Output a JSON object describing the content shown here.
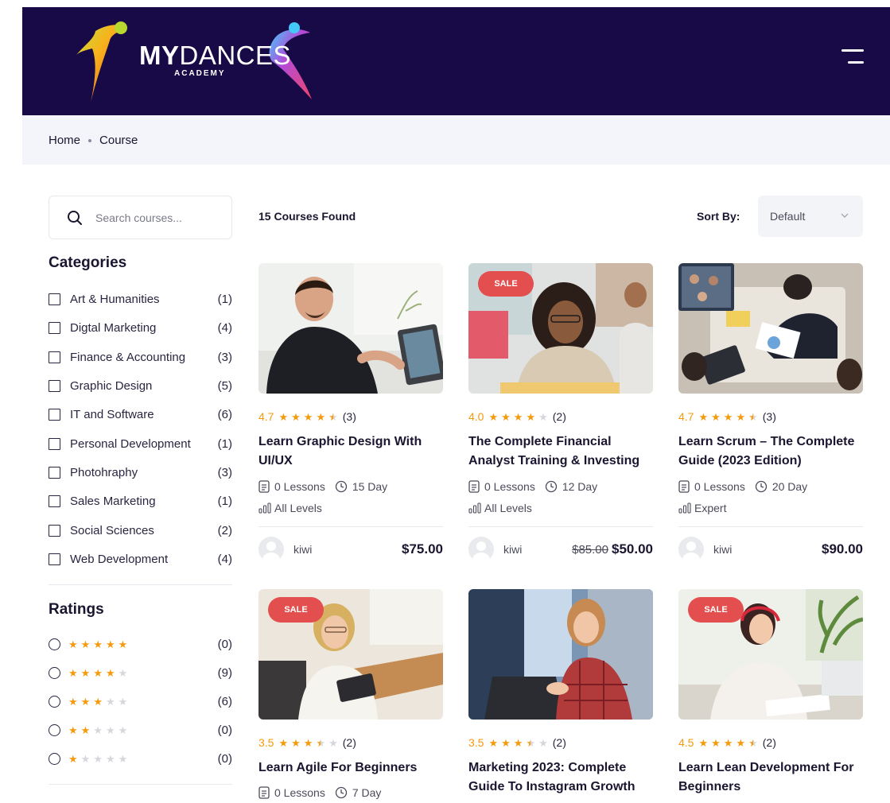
{
  "brand": {
    "name_bold": "MY",
    "name_regular": "DANCES",
    "tagline": "ACADEMY"
  },
  "breadcrumb": {
    "home": "Home",
    "current": "Course"
  },
  "search": {
    "placeholder": "Search courses..."
  },
  "categories": {
    "title": "Categories",
    "items": [
      {
        "label": "Art & Humanities",
        "count": "(1)"
      },
      {
        "label": "Digtal Marketing",
        "count": "(4)"
      },
      {
        "label": "Finance & Accounting",
        "count": "(3)"
      },
      {
        "label": "Graphic Design",
        "count": "(5)"
      },
      {
        "label": "IT and Software",
        "count": "(6)"
      },
      {
        "label": "Personal Development",
        "count": "(1)"
      },
      {
        "label": "Photohraphy",
        "count": "(3)"
      },
      {
        "label": "Sales Marketing",
        "count": "(1)"
      },
      {
        "label": "Social Sciences",
        "count": "(2)"
      },
      {
        "label": "Web Development",
        "count": "(4)"
      }
    ]
  },
  "ratings": {
    "title": "Ratings",
    "items": [
      {
        "stars": 5,
        "count": "(0)"
      },
      {
        "stars": 4,
        "count": "(9)"
      },
      {
        "stars": 3,
        "count": "(6)"
      },
      {
        "stars": 2,
        "count": "(0)"
      },
      {
        "stars": 1,
        "count": "(0)"
      }
    ]
  },
  "toolbar": {
    "found": "15 Courses Found",
    "sort_label": "Sort By:",
    "sort_value": "Default"
  },
  "sale_label": "SALE",
  "courses": [
    {
      "rating": "4.7",
      "rating_value": 4.7,
      "reviews": "(3)",
      "title": "Learn Graphic Design With UI/UX",
      "lessons": "0 Lessons",
      "duration": "15 Day",
      "level": "All Levels",
      "author": "kiwi",
      "old_price": "",
      "price": "$75.00"
    },
    {
      "rating": "4.0",
      "rating_value": 4.0,
      "reviews": "(2)",
      "title": "The Complete Financial Analyst Training & Investing",
      "lessons": "0 Lessons",
      "duration": "12 Day",
      "level": "All Levels",
      "author": "kiwi",
      "old_price": "$85.00",
      "price": "$50.00"
    },
    {
      "rating": "4.7",
      "rating_value": 4.7,
      "reviews": "(3)",
      "title": "Learn Scrum – The Complete Guide (2023 Edition)",
      "lessons": "0 Lessons",
      "duration": "20 Day",
      "level": "Expert",
      "author": "kiwi",
      "old_price": "",
      "price": "$90.00"
    },
    {
      "rating": "3.5",
      "rating_value": 3.5,
      "reviews": "(2)",
      "title": "Learn Agile For Beginners",
      "lessons": "0 Lessons",
      "duration": "7 Day"
    },
    {
      "rating": "3.5",
      "rating_value": 3.5,
      "reviews": "(2)",
      "title": "Marketing 2023: Complete Guide To Instagram Growth"
    },
    {
      "rating": "4.5",
      "rating_value": 4.5,
      "reviews": "(2)",
      "title": "Learn Lean Development For Beginners"
    }
  ],
  "icons": {
    "menu": "hamburger-icon",
    "search": "search-icon",
    "sort": "chevron-down-icon",
    "lessons": "document-icon",
    "duration": "clock-icon",
    "level": "bar-chart-icon",
    "author": "avatar-icon"
  },
  "colors": {
    "header_bg": "#170a46",
    "accent_star": "#f59a0c",
    "sale_badge": "#e34f4f",
    "breadcrumb_bg": "#f3f5fa"
  }
}
